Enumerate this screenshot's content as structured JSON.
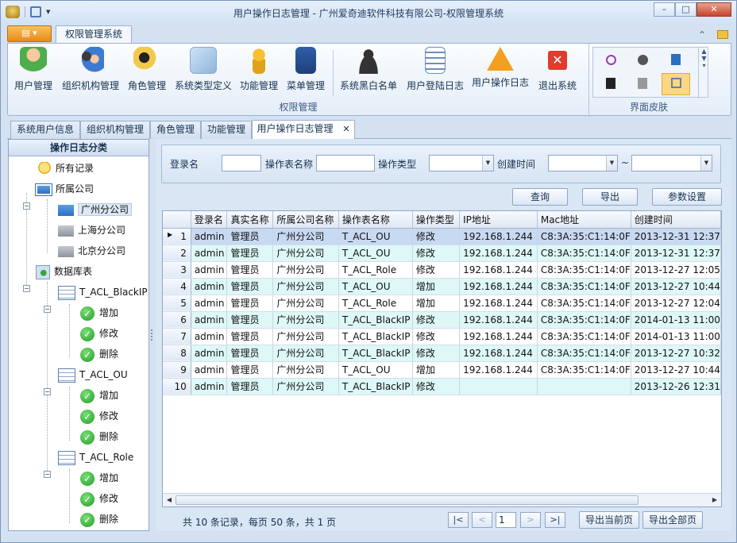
{
  "window": {
    "title": "用户操作日志管理 - 广州爱奇迪软件科技有限公司-权限管理系统",
    "controls": [
      "–",
      "□",
      "✕"
    ]
  },
  "ribbon": {
    "app_button": "▤ ▾",
    "tab": "权限管理系统",
    "group_label": "权限管理",
    "skin_group_label": "界面皮肤",
    "buttons": [
      {
        "label": "用户管理",
        "icon": "user-icon"
      },
      {
        "label": "组织机构管理",
        "icon": "org-users-icon"
      },
      {
        "label": "角色管理",
        "icon": "role-key-icon"
      },
      {
        "label": "系统类型定义",
        "icon": "system-type-icon"
      },
      {
        "label": "功能管理",
        "icon": "key-icon"
      },
      {
        "label": "菜单管理",
        "icon": "menu-icon"
      },
      {
        "label": "系统黑白名单",
        "icon": "person-silhouette-icon"
      },
      {
        "label": "用户登陆日志",
        "icon": "login-log-icon"
      },
      {
        "label": "用户操作日志",
        "icon": "warning-icon"
      },
      {
        "label": "退出系统",
        "icon": "exit-icon"
      }
    ]
  },
  "doc_tabs": [
    "系统用户信息",
    "组织机构管理",
    "角色管理",
    "功能管理",
    "用户操作日志管理"
  ],
  "doc_tab_close": "✕",
  "left_panel": {
    "title": "操作日志分类",
    "tree": {
      "all": "所有记录",
      "company": "所属公司",
      "branches": [
        "广州分公司",
        "上海分公司",
        "北京分公司"
      ],
      "db": "数据库表",
      "tables": [
        {
          "name": "T_ACL_BlackIP",
          "ops": [
            "增加",
            "修改",
            "删除"
          ]
        },
        {
          "name": "T_ACL_OU",
          "ops": [
            "增加",
            "修改",
            "删除"
          ]
        },
        {
          "name": "T_ACL_Role",
          "ops": [
            "增加",
            "修改",
            "删除"
          ]
        }
      ]
    }
  },
  "filter": {
    "login_label": "登录名",
    "table_label": "操作表名称",
    "type_label": "操作类型",
    "time_label": "创建时间",
    "tilde": "~",
    "query_btn": "查询",
    "export_btn": "导出",
    "settings_btn": "参数设置"
  },
  "grid": {
    "columns": [
      "登录名",
      "真实名称",
      "所属公司名称",
      "操作表名称",
      "操作类型",
      "IP地址",
      "Mac地址",
      "创建时间"
    ],
    "rows": [
      [
        "1",
        "admin",
        "管理员",
        "广州分公司",
        "T_ACL_OU",
        "修改",
        "192.168.1.244",
        "C8:3A:35:C1:14:0F",
        "2013-12-31 12:37"
      ],
      [
        "2",
        "admin",
        "管理员",
        "广州分公司",
        "T_ACL_OU",
        "修改",
        "192.168.1.244",
        "C8:3A:35:C1:14:0F",
        "2013-12-31 12:37"
      ],
      [
        "3",
        "admin",
        "管理员",
        "广州分公司",
        "T_ACL_Role",
        "修改",
        "192.168.1.244",
        "C8:3A:35:C1:14:0F",
        "2013-12-27 12:05"
      ],
      [
        "4",
        "admin",
        "管理员",
        "广州分公司",
        "T_ACL_OU",
        "增加",
        "192.168.1.244",
        "C8:3A:35:C1:14:0F",
        "2013-12-27 10:44"
      ],
      [
        "5",
        "admin",
        "管理员",
        "广州分公司",
        "T_ACL_Role",
        "增加",
        "192.168.1.244",
        "C8:3A:35:C1:14:0F",
        "2013-12-27 12:04"
      ],
      [
        "6",
        "admin",
        "管理员",
        "广州分公司",
        "T_ACL_BlackIP",
        "修改",
        "192.168.1.244",
        "C8:3A:35:C1:14:0F",
        "2014-01-13 11:00"
      ],
      [
        "7",
        "admin",
        "管理员",
        "广州分公司",
        "T_ACL_BlackIP",
        "修改",
        "192.168.1.244",
        "C8:3A:35:C1:14:0F",
        "2014-01-13 11:00"
      ],
      [
        "8",
        "admin",
        "管理员",
        "广州分公司",
        "T_ACL_BlackIP",
        "修改",
        "192.168.1.244",
        "C8:3A:35:C1:14:0F",
        "2013-12-27 10:32"
      ],
      [
        "9",
        "admin",
        "管理员",
        "广州分公司",
        "T_ACL_OU",
        "增加",
        "192.168.1.244",
        "C8:3A:35:C1:14:0F",
        "2013-12-27 10:44"
      ],
      [
        "10",
        "admin",
        "管理员",
        "广州分公司",
        "T_ACL_BlackIP",
        "修改",
        "",
        "",
        "2013-12-26 12:31"
      ]
    ]
  },
  "pager": {
    "summary": "共 10 条记录，每页 50 条，共 1 页",
    "first": "|<",
    "prev": "<",
    "page": "1",
    "next": ">",
    "last": ">|",
    "export_page": "导出当前页",
    "export_all": "导出全部页"
  }
}
